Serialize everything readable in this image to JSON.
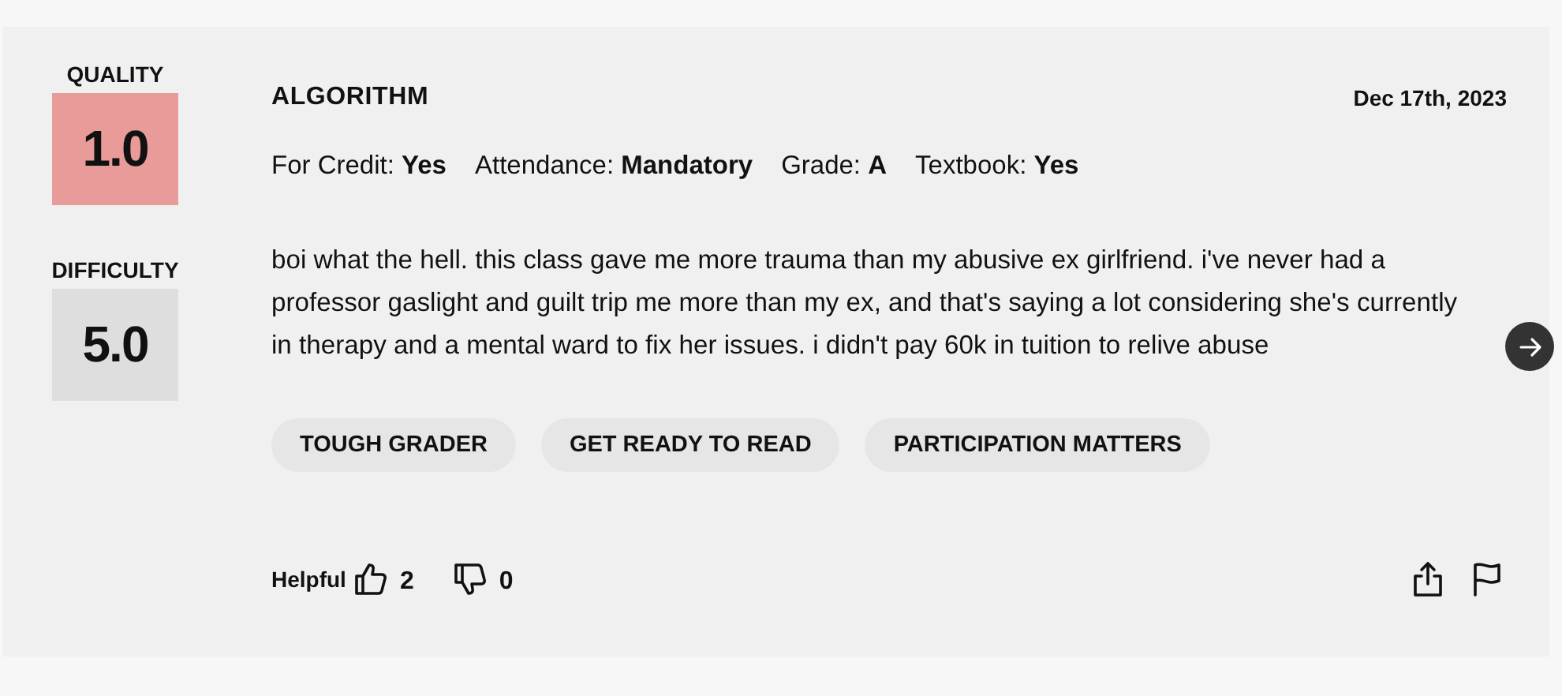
{
  "ratings": [
    {
      "label": "QUALITY",
      "value": "1.0",
      "color": "#e89b98"
    },
    {
      "label": "DIFFICULTY",
      "value": "5.0",
      "color": "#dedede"
    }
  ],
  "review": {
    "course": "ALGORITHM",
    "date": "Dec 17th, 2023",
    "meta": [
      "For Credit: **Yes**",
      "Attendance: **Mandatory**",
      "Grade: **A**",
      "Textbook: **Yes**"
    ],
    "comment": "boi what the hell. this class gave me more trauma than my abusive ex girlfriend. i've never had a professor gaslight and guilt trip me more than my ex, and that's saying a lot considering she's currently in therapy and a mental ward to fix her issues. i didn't pay 60k in tuition to relive abuse",
    "tags": [
      "TOUGH GRADER",
      "GET READY TO READ",
      "PARTICIPATION MATTERS"
    ],
    "helpful": {
      "label": "Helpful",
      "up": "2",
      "down": "0"
    }
  }
}
